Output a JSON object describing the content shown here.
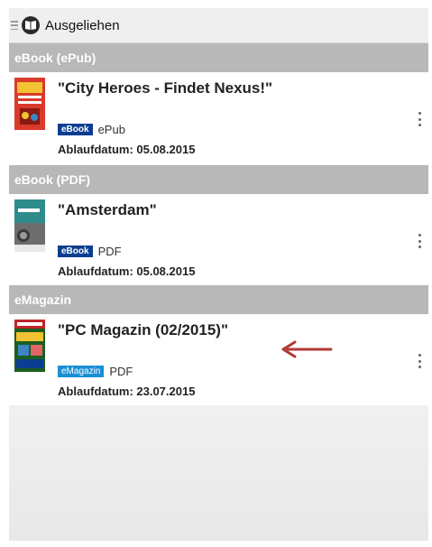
{
  "header": {
    "title": "Ausgeliehen",
    "menu_icon": "hamburger-icon",
    "app_icon": "book-icon"
  },
  "sections": [
    {
      "label": "eBook (ePub)",
      "items": [
        {
          "title": "\"City Heroes - Findet Nexus!\"",
          "badge": "eBook",
          "format": "ePub",
          "expiry": "Ablaufdatum: 05.08.2015",
          "cover_color": "#d93a2b"
        }
      ]
    },
    {
      "label": "eBook (PDF)",
      "items": [
        {
          "title": "\"Amsterdam\"",
          "badge": "eBook",
          "format": "PDF",
          "expiry": "Ablaufdatum: 05.08.2015",
          "cover_color": "#2e8c8c"
        }
      ]
    },
    {
      "label": "eMagazin",
      "items": [
        {
          "title": "\"PC Magazin (02/2015)\"",
          "badge": "eMagazin",
          "format": "PDF",
          "expiry": "Ablaufdatum: 23.07.2015",
          "cover_color": "#c0262c"
        }
      ]
    }
  ],
  "colors": {
    "section_bg": "#b8b8b8",
    "badge_ebook": "#0b3d91",
    "badge_emagazin": "#1a8fd6",
    "arrow": "#b03a35"
  }
}
